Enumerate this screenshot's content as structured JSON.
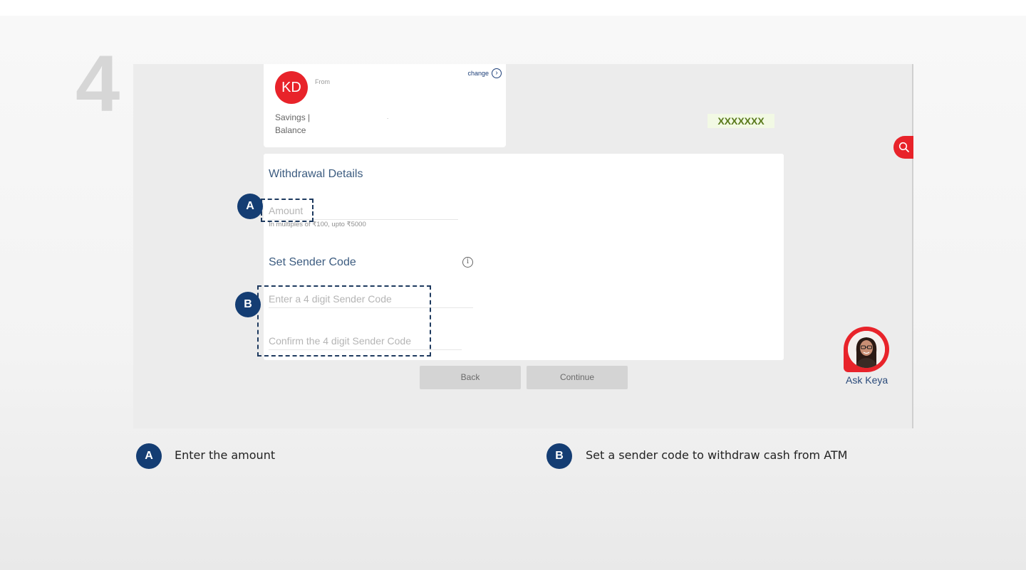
{
  "step_number": "4",
  "account": {
    "initials": "KD",
    "from_label": "From",
    "change_label": "change",
    "type_label": "Savings |",
    "balance_label": "Balance",
    "dot": "."
  },
  "masked_value": "XXXXXXX",
  "withdrawal": {
    "title": "Withdrawal Details",
    "amount_placeholder": "Amount",
    "amount_hint": "In multiples of ₹100, upto ₹5000"
  },
  "sender_code": {
    "title": "Set Sender Code",
    "enter_placeholder": "Enter a 4 digit Sender Code",
    "confirm_placeholder": "Confirm the 4 digit Sender Code"
  },
  "buttons": {
    "back": "Back",
    "continue": "Continue"
  },
  "assistant": {
    "label": "Ask Keya"
  },
  "annotations": [
    {
      "marker": "A",
      "text": "Enter the amount"
    },
    {
      "marker": "B",
      "text": "Set a sender code to withdraw cash from ATM"
    }
  ],
  "colors": {
    "brand_red": "#e8232a",
    "marker_blue": "#143d73",
    "title_blue": "#3c5c80"
  }
}
